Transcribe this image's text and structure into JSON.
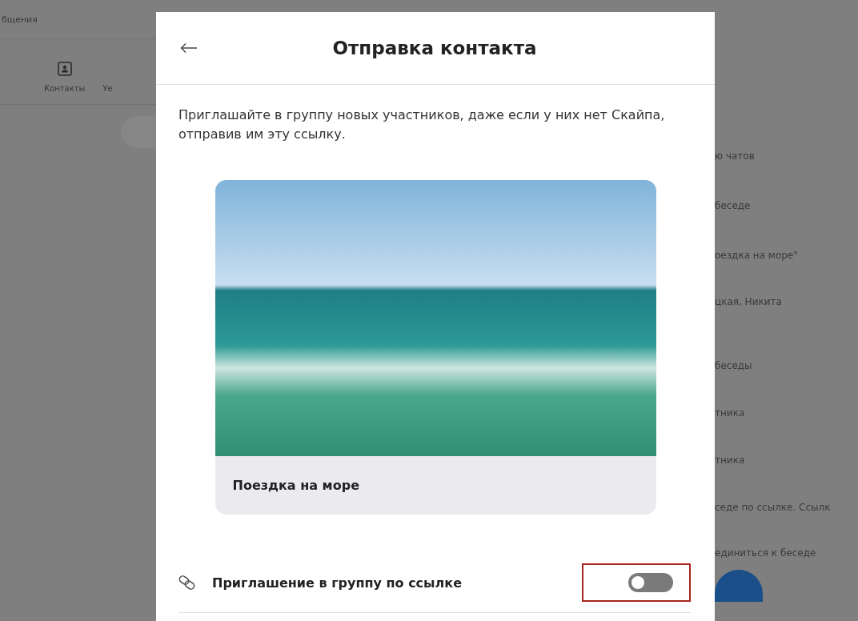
{
  "background": {
    "header_title": "бщения",
    "nav": [
      {
        "label": "Контакты",
        "kind": "contacts"
      },
      {
        "label": "Уе",
        "kind": "text"
      }
    ],
    "side_texts": [
      "ю чатов",
      "беседе",
      "оездка на море\"",
      "цкая, Никита",
      "беседы",
      "тника",
      "тника",
      "седе по ссылке. Ссылк",
      "единиться к беседе"
    ]
  },
  "dialog": {
    "title": "Отправка контакта",
    "description": "Приглашайте в группу новых участников, даже если у них нет Скайпа, отправив им эту ссылку.",
    "card": {
      "caption": "Поездка на море"
    },
    "invite_toggle": {
      "label": "Приглашение в группу по ссылке",
      "on": false,
      "highlighted": true
    }
  }
}
